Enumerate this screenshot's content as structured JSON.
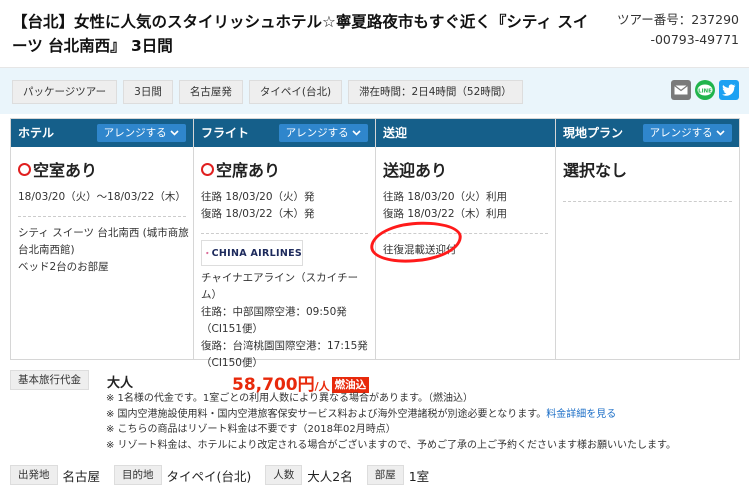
{
  "header": {
    "title": "【台北】女性に人気のスタイリッシュホテル☆寧夏路夜市もすぐ近く『シティ スイーツ 台北南西』 3日間",
    "tour_no_label": "ツアー番号：237290",
    "tour_no_cont": "-00793-49771"
  },
  "chips": [
    "パッケージツアー",
    "3日間",
    "名古屋発",
    "タイペイ(台北)",
    "滞在時間：2日4時間（52時間）"
  ],
  "share": {
    "mail": "mail-icon",
    "line": "LINE",
    "twitter": "twitter-icon"
  },
  "columns": {
    "hotel": {
      "title": "ホテル",
      "button": "アレンジする",
      "status": "空室あり",
      "dates": "18/03/20（火）〜18/03/22（木）",
      "name_1": "シティ スイーツ 台北南西 (城市商旅",
      "name_2": "台北南西館)",
      "room": "ベッド2台のお部屋"
    },
    "flight": {
      "title": "フライト",
      "button": "アレンジする",
      "status": "空席あり",
      "out": "往路 18/03/20（火）発",
      "ret": "復路 18/03/22（木）発",
      "airline_logo": "CHINA AIRLINES",
      "airline_1": "チャイナエアライン（スカイチー",
      "airline_2": "ム）",
      "out_detail": "往路：中部国際空港：09:50発",
      "out_flight": "（CI151便）",
      "ret_detail": "復路：台湾桃園国際空港：17:15発",
      "ret_flight": "（CI150便）"
    },
    "transfer": {
      "title": "送迎",
      "status": "送迎あり",
      "out": "往路 18/03/20（火）利用",
      "ret": "復路 18/03/22（木）利用",
      "detail": "往復混載送迎付"
    },
    "local": {
      "title": "現地プラン",
      "button": "アレンジする",
      "status": "選択なし"
    }
  },
  "pricing": {
    "label": "基本旅行代金",
    "adult": "大人",
    "price": "58,700円",
    "per": "/人",
    "fuel": "燃油込"
  },
  "notes": [
    "※ 1名様の代金です。1室ごとの利用人数により異なる場合があります。（燃油込）",
    "※ 国内空港施設使用料・国内空港旅客保安サービス料および海外空港諸税が別途必要となります。",
    "※ こちらの商品はリゾート料金は不要です（2018年02月時点）",
    "※ リゾート料金は、ホテルにより改定される場合がございますので、予めご了承の上ご予約くださいます様お願いいたします。"
  ],
  "notes_link": "料金詳細を見る",
  "summary": {
    "origin_label": "出発地",
    "origin": "名古屋",
    "dest_label": "目的地",
    "dest": "タイペイ(台北)",
    "people_label": "人数",
    "people": "大人2名",
    "rooms_label": "部屋",
    "rooms": "1室"
  }
}
